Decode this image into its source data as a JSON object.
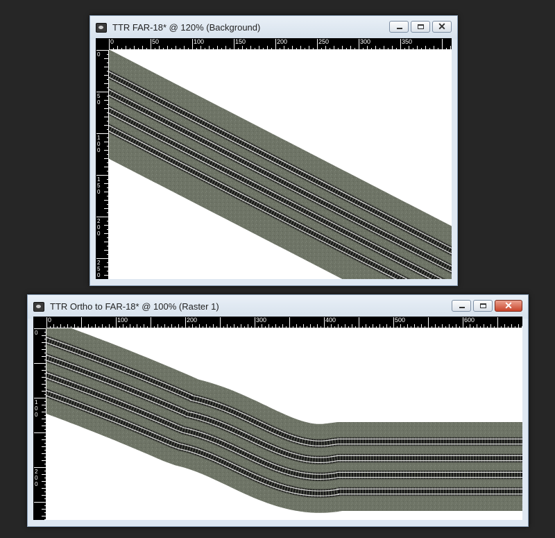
{
  "window1": {
    "title": "TTR FAR-18* @ 120% (Background)",
    "ruler_h": [
      "0",
      "50",
      "100",
      "150",
      "200",
      "250",
      "300",
      "350"
    ],
    "ruler_v": [
      "0",
      "50",
      "100",
      "150",
      "200",
      "250"
    ]
  },
  "window2": {
    "title": "TTR Ortho to FAR-18* @ 100% (Raster 1)",
    "ruler_h": [
      "0",
      "100",
      "200",
      "300",
      "400",
      "500",
      "600"
    ],
    "ruler_v": [
      "0",
      "100",
      "200"
    ]
  },
  "colors": {
    "terrain": "#6e7466",
    "tie": "#171717",
    "rail": "#e6e6e6",
    "ballast": "#4a4d45"
  },
  "icons": [
    "app-icon",
    "minimize-icon",
    "maximize-icon",
    "close-icon"
  ]
}
